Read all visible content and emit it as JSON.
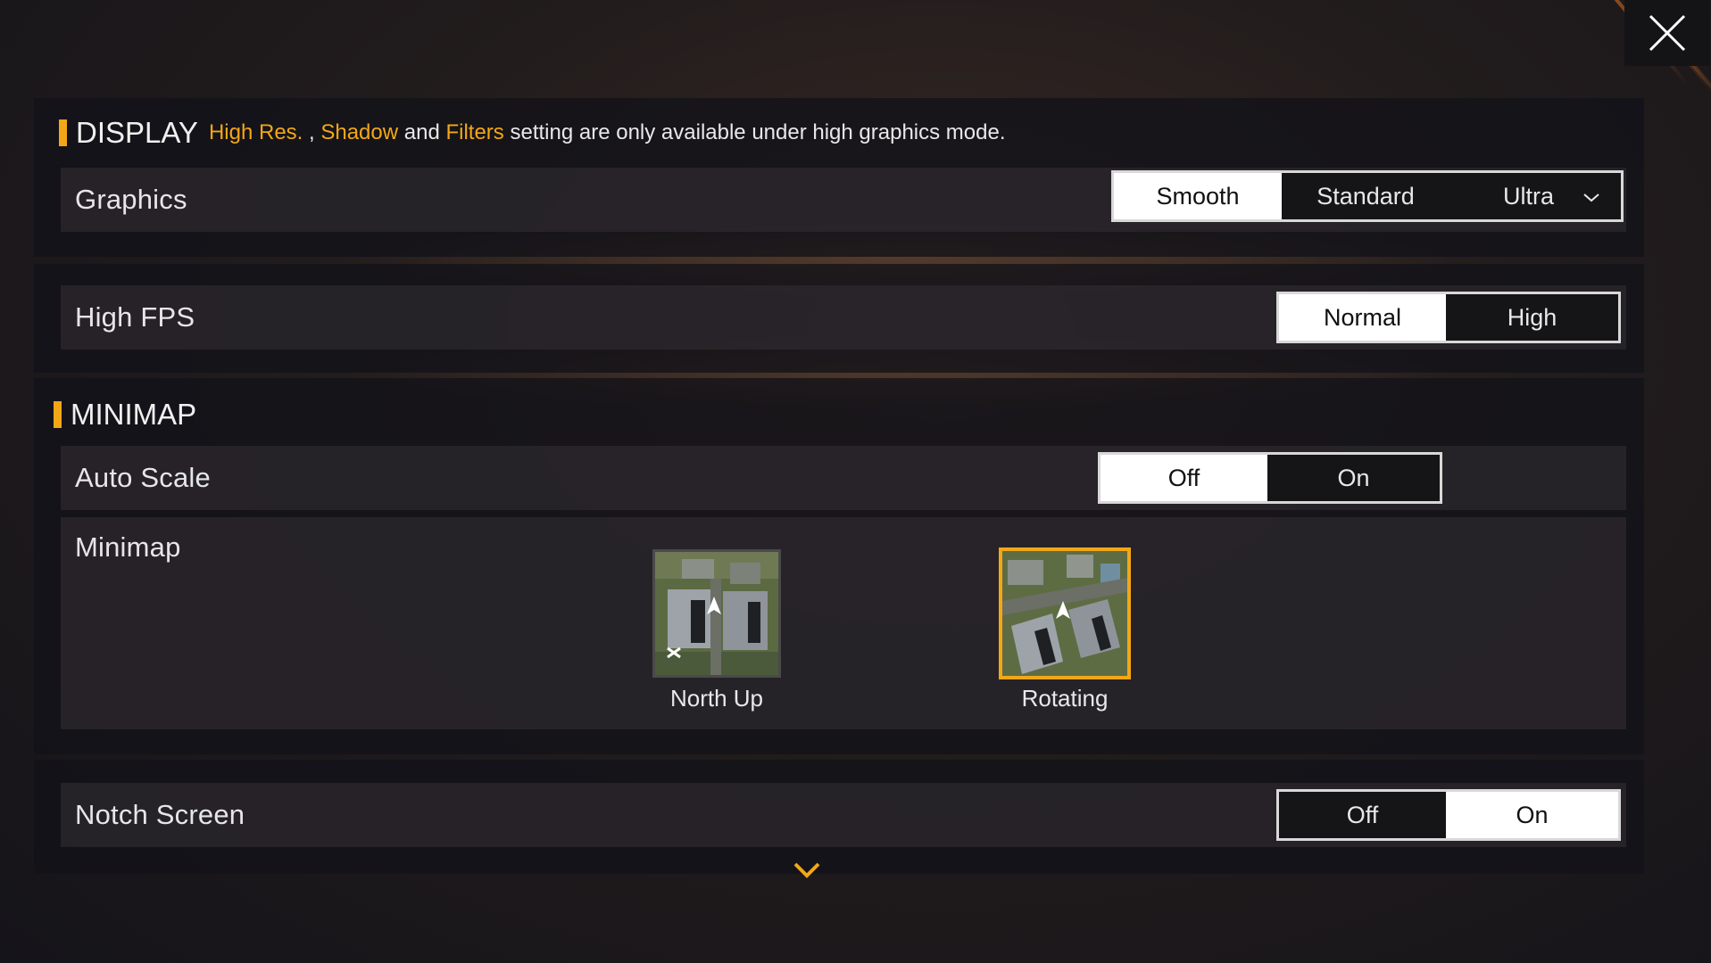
{
  "display": {
    "title": "DISPLAY",
    "note": {
      "hl1": "High Res.",
      "sep1": " , ",
      "hl2": "Shadow",
      "sep2": " and ",
      "hl3": "Filters",
      "rest": " setting are only available under high graphics mode."
    }
  },
  "graphics": {
    "label": "Graphics",
    "options": [
      "Smooth",
      "Standard",
      "Ultra"
    ],
    "selected": "Smooth"
  },
  "high_fps": {
    "label": "High FPS",
    "options": [
      "Normal",
      "High"
    ],
    "selected": "Normal"
  },
  "minimap_section": {
    "title": "MINIMAP"
  },
  "auto_scale": {
    "label": "Auto Scale",
    "options": [
      "Off",
      "On"
    ],
    "selected": "Off"
  },
  "minimap": {
    "label": "Minimap",
    "choices": [
      {
        "label": "North Up",
        "icon": "north-up-map-thumbnail"
      },
      {
        "label": "Rotating",
        "icon": "rotating-map-thumbnail"
      }
    ],
    "selected": "Rotating"
  },
  "notch_screen": {
    "label": "Notch Screen",
    "options": [
      "Off",
      "On"
    ],
    "selected": "On"
  },
  "colors": {
    "accent": "#f3a717",
    "active_option_bg": "#ffffff",
    "active_option_text": "#111111"
  },
  "icons": {
    "close": "close-icon",
    "dropdown": "chevron-down-icon",
    "scroll_more": "chevron-down-icon"
  }
}
